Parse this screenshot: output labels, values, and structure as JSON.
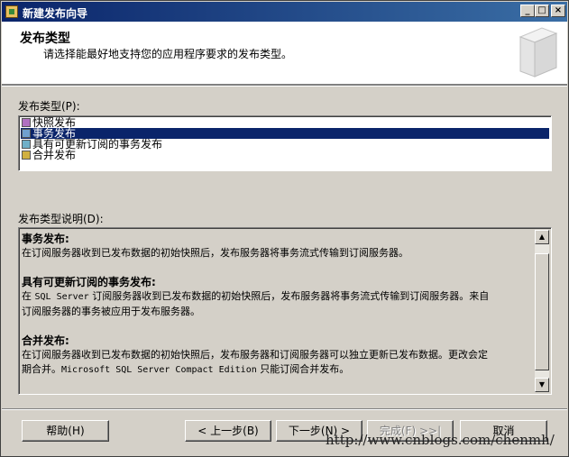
{
  "window": {
    "title": "新建发布向导",
    "controls": [
      "_",
      "□",
      "×"
    ]
  },
  "header": {
    "title": "发布类型",
    "subtitle": "请选择能最好地支持您的应用程序要求的发布类型。"
  },
  "list": {
    "label": "发布类型(P):",
    "items": [
      {
        "label": "快照发布",
        "icon": "snapshot-publication-icon",
        "selected": false
      },
      {
        "label": "事务发布",
        "icon": "transactional-publication-icon",
        "selected": true
      },
      {
        "label": "具有可更新订阅的事务发布",
        "icon": "updatable-transactional-publication-icon",
        "selected": false
      },
      {
        "label": "合并发布",
        "icon": "merge-publication-icon",
        "selected": false
      }
    ]
  },
  "description": {
    "label": "发布类型说明(D):",
    "blocks": [
      {
        "heading": "事务发布:",
        "lines": [
          "在订阅服务器收到已发布数据的初始快照后，发布服务器将事务流式传输到订阅服务器。"
        ]
      },
      {
        "heading": "具有可更新订阅的事务发布:",
        "line1_a": "在 ",
        "line1_mono": "SQL Server",
        "line1_b": " 订阅服务器收到已发布数据的初始快照后，发布服务器将事务流式传输到订阅服务器。来自",
        "line2": "订阅服务器的事务被应用于发布服务器。"
      },
      {
        "heading": "合并发布:",
        "line1": "在订阅服务器收到已发布数据的初始快照后，发布服务器和订阅服务器可以独立更新已发布数据。更改会定",
        "line2_a": "期合并。",
        "line2_mono": "Microsoft SQL Server Compact Edition",
        "line2_b": " 只能订阅合并发布。"
      }
    ]
  },
  "buttons": {
    "help": "帮助(H)",
    "back": "< 上一步(B)",
    "next": "下一步(N) >",
    "finish": "完成(F) >>|",
    "cancel": "取消"
  },
  "watermark": "http://www.cnblogs.com/chenmh/"
}
